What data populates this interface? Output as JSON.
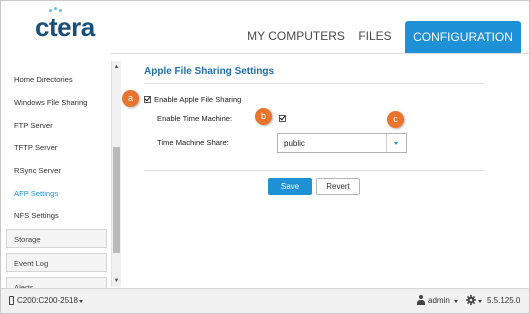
{
  "header": {
    "logo": "ctera",
    "tabs": {
      "my_computers": "MY COMPUTERS",
      "files": "FILES",
      "configuration": "CONFIGURATION"
    }
  },
  "sidebar": {
    "items": [
      {
        "label": "Home Directories"
      },
      {
        "label": "Windows File Sharing"
      },
      {
        "label": "FTP Server"
      },
      {
        "label": "TFTP Server"
      },
      {
        "label": "RSync Server"
      },
      {
        "label": "AFP Settings"
      },
      {
        "label": "NFS Settings"
      }
    ],
    "sections": [
      {
        "label": "Storage"
      },
      {
        "label": "Event Log"
      },
      {
        "label": "Alerts"
      }
    ]
  },
  "main": {
    "title": "Apple File Sharing Settings",
    "enable_afp_label": "Enable Apple File Sharing",
    "enable_time_machine_label": "Enable Time Machine:",
    "time_machine_share_label": "Time Machine Share:",
    "time_machine_share_value": "public",
    "save_label": "Save",
    "revert_label": "Revert"
  },
  "callouts": {
    "a": "a",
    "b": "b",
    "c": "c"
  },
  "statusbar": {
    "device": "C200:C200-2518",
    "user": "admin",
    "version": "5.5.125.0"
  },
  "colors": {
    "accent": "#1e90d6",
    "callout": "#e8742e",
    "logo": "#1b4f7b"
  }
}
